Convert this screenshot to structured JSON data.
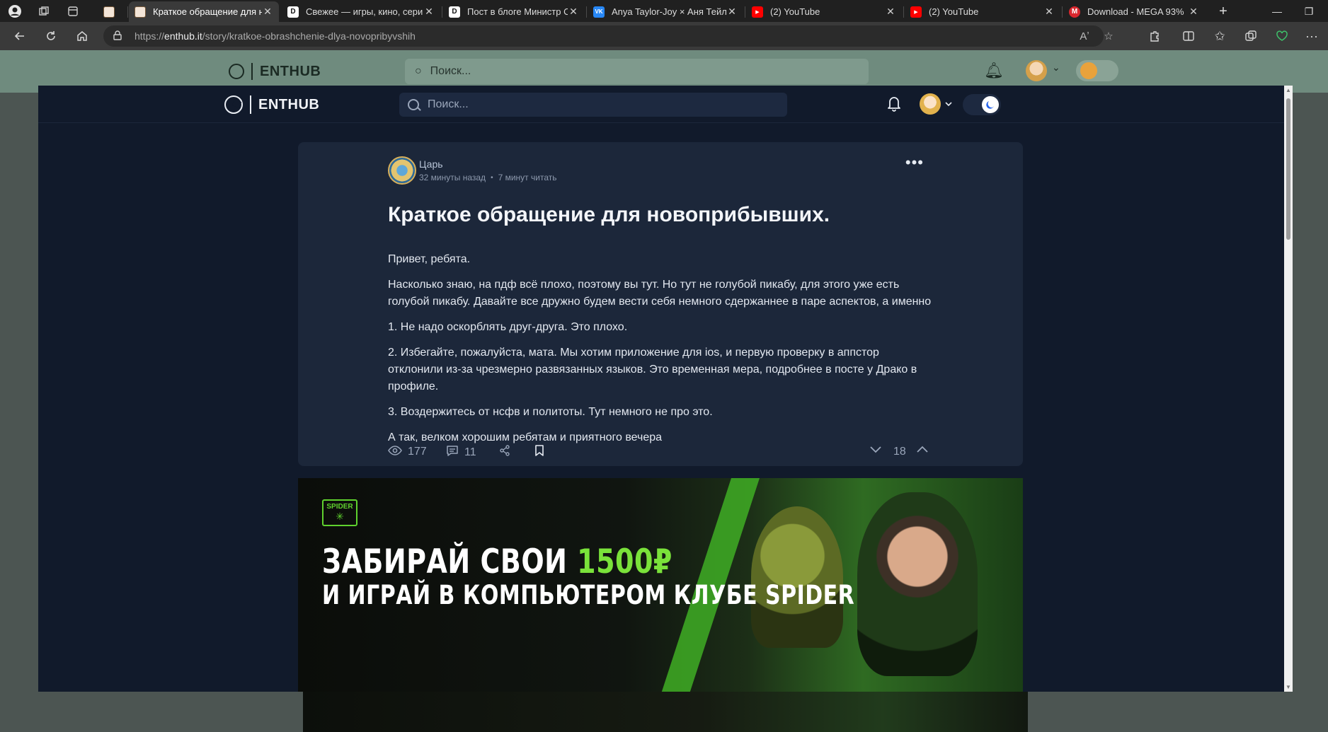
{
  "browser": {
    "tabs": [
      {
        "title": "",
        "favicon": "enthub",
        "fav_color": "#3a2a20"
      },
      {
        "title": "Краткое обращение для но",
        "favicon": "enthub",
        "fav_color": "#3a2a20",
        "active": true
      },
      {
        "title": "Свежее — игры, кино, сери",
        "favicon": "D",
        "fav_color": "#ffffff"
      },
      {
        "title": "Пост в блоге Министр Орте",
        "favicon": "D",
        "fav_color": "#ffffff"
      },
      {
        "title": "Anya Taylor-Joy × Аня Тейло",
        "favicon": "VK",
        "fav_color": "#2787f5"
      },
      {
        "title": "(2) YouTube",
        "favicon": "yt",
        "fav_color": "#ff0000"
      },
      {
        "title": "(2) YouTube",
        "favicon": "yt",
        "fav_color": "#ff0000"
      },
      {
        "title": "Download - MEGA 93%",
        "favicon": "M",
        "fav_color": "#d9272e"
      }
    ],
    "url_prefix": "https://",
    "url_host": "enthub.it",
    "url_path": "/story/kratkoe-obrashchenie-dlya-novopribyvshih"
  },
  "site": {
    "logo_text": "ENTHUB",
    "search_placeholder": "Поиск..."
  },
  "post": {
    "author": "Царь",
    "time_ago": "32 минуты назад",
    "read_time": "7 минут читать",
    "title": "Краткое обращение для новоприбывших.",
    "paragraphs": [
      "Привет, ребята.",
      "Насколько знаю, на пдф всё плохо, поэтому вы тут. Но тут не голубой пикабу, для этого уже есть голубой пикабу. Давайте все дружно будем вести себя немного сдержаннее в паре аспектов, а именно",
      "1. Не надо оскорблять друг-друга. Это плохо.",
      "2. Избегайте, пожалуйста, мата. Мы хотим приложение для ios, и первую проверку в аппстор отклонили из-за чрезмерно развязанных языков. Это временная мера, подробнее в посте у Драко в профиле.",
      "3. Воздержитесь от нсфв и политоты. Тут немного не про это.",
      "А так, велком хорошим ребятам и приятного вечера"
    ],
    "views": "177",
    "comments": "11",
    "rating": "18"
  },
  "banner": {
    "logo_text": "SPIDER",
    "line1_pre": "ЗАБИРАЙ СВОИ ",
    "line1_accent": "1500₽",
    "line2": "И ИГРАЙ В КОМПЬЮТЕРОМ КЛУБЕ SPIDER"
  },
  "colors": {
    "page_bg": "#111a2b",
    "card_bg": "#1c273a",
    "accent_blue": "#2563eb",
    "banner_green": "#7ae23a"
  }
}
